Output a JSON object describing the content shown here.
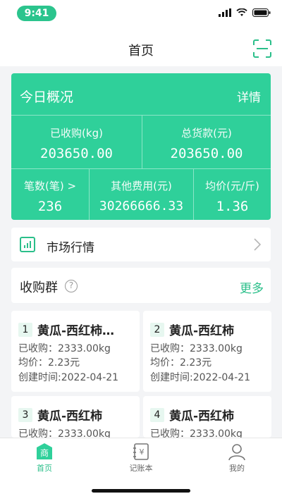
{
  "status_bar": {
    "time": "9:41"
  },
  "header": {
    "title": "首页",
    "scan_icon": "scan-icon"
  },
  "overview": {
    "title": "今日概况",
    "detail_label": "详情",
    "purchased_label": "已收购(kg)",
    "purchased_value": "203650.00",
    "total_payment_label": "总货款(元)",
    "total_payment_value": "203650.00",
    "count_label": "笔数(笔) >",
    "count_value": "236",
    "other_fee_label": "其他费用(元)",
    "other_fee_value": "30266666.33",
    "avg_price_label": "均价(元/斤)",
    "avg_price_value": "1.36"
  },
  "market": {
    "label": "市场行情"
  },
  "groups": {
    "title": "收购群",
    "more_label": "更多",
    "cards": [
      {
        "index": "1",
        "name": "黄瓜-西红柿…",
        "purchased": "已收购：2333.00kg",
        "avg_price": "均价：2.23元",
        "created": "创建时间:2022-04-21"
      },
      {
        "index": "2",
        "name": "黄瓜-西红柿",
        "purchased": "已收购：2333.00kg",
        "avg_price": "均价：2.23元",
        "created": "创建时间:2022-04-21"
      },
      {
        "index": "3",
        "name": "黄瓜-西红柿",
        "purchased": "已收购：2333.00kg"
      },
      {
        "index": "4",
        "name": "黄瓜-西红柿",
        "purchased": "已收购：2333.00kg"
      }
    ]
  },
  "tabbar": {
    "items": [
      {
        "label": "首页",
        "icon": "shop-icon",
        "active": true
      },
      {
        "label": "记账本",
        "icon": "ledger-icon",
        "active": false
      },
      {
        "label": "我的",
        "icon": "user-icon",
        "active": false
      }
    ]
  },
  "colors": {
    "accent": "#2fd09a",
    "accent_text": "#2bbf8a",
    "background": "#f3f4f6"
  }
}
